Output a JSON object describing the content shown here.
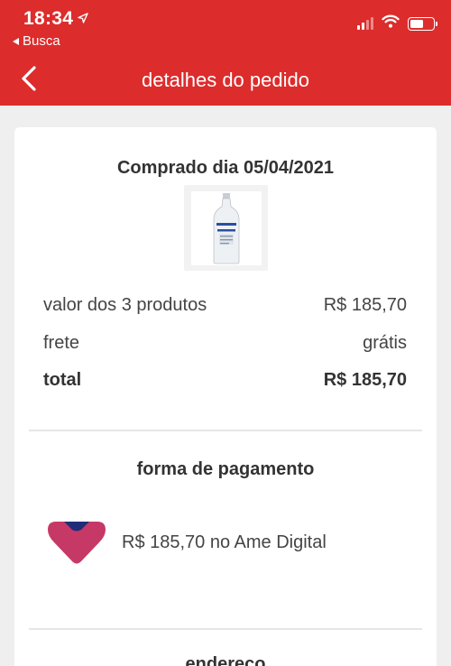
{
  "status_bar": {
    "time": "18:34",
    "back_label": "Busca"
  },
  "nav": {
    "title": "detalhes do pedido"
  },
  "order": {
    "purchase_date": "Comprado dia 05/04/2021",
    "summary": {
      "products_label": "valor dos 3 produtos",
      "products_value": "R$ 185,70",
      "shipping_label": "frete",
      "shipping_value": "grátis",
      "total_label": "total",
      "total_value": "R$ 185,70"
    },
    "payment": {
      "section_title": "forma de pagamento",
      "method_text": "R$ 185,70 no Ame Digital"
    },
    "address": {
      "section_title": "endereço"
    }
  },
  "colors": {
    "brand_red": "#dd2c2c",
    "ame_pink": "#c63865",
    "ame_navy": "#1f2d78"
  },
  "icons": [
    "location-arrow-icon",
    "back-triangle-icon",
    "signal-icon",
    "wifi-icon",
    "battery-icon",
    "chevron-left-icon",
    "vodka-bottle-image",
    "ame-digital-logo-icon"
  ]
}
